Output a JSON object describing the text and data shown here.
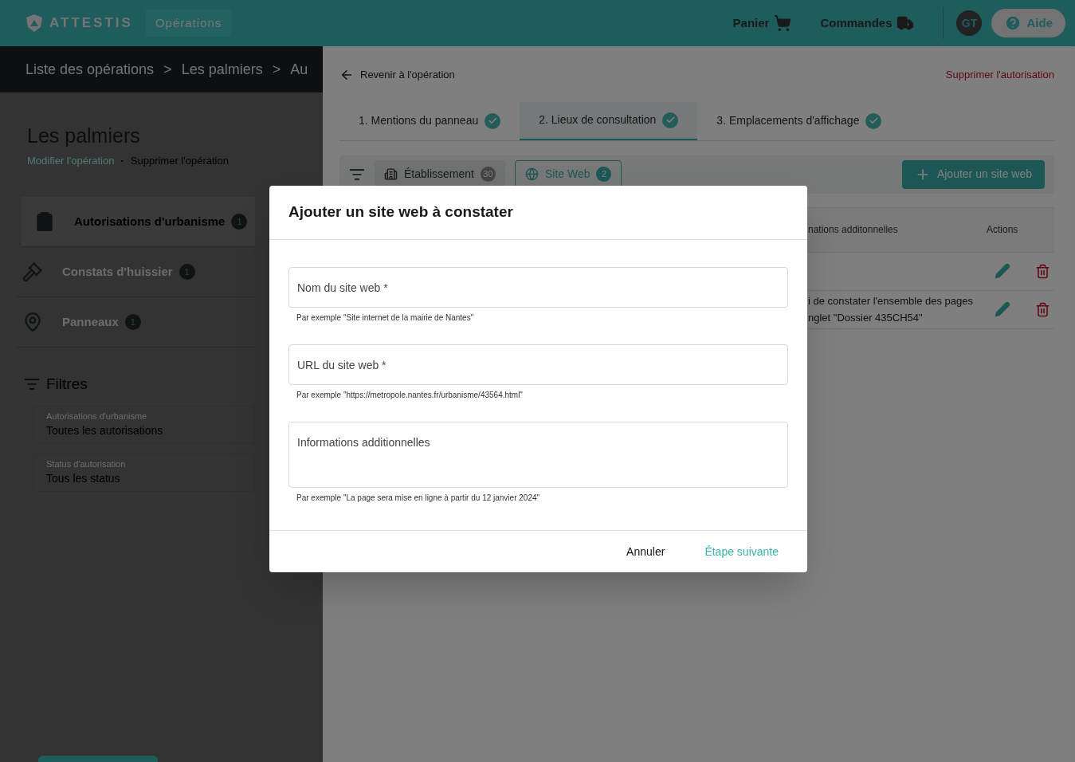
{
  "header": {
    "logo_text": "ATTESTIS",
    "nav_item": "Opérations",
    "links": [
      {
        "kind": "cart",
        "label": "Panier"
      },
      {
        "kind": "truck",
        "label": "Commandes"
      }
    ],
    "avatar": "GT",
    "help_button": "Aide"
  },
  "breadcrumb": {
    "items": [
      "Liste des opérations",
      "Les palmiers",
      "Au"
    ],
    "separator": ">"
  },
  "operation": {
    "title": "Les palmiers",
    "edit_link": "Modifier l'opération",
    "separator": "·",
    "delete_link": "Supprimer l'opération"
  },
  "sidebar": {
    "items": [
      {
        "kind": "clipboard",
        "label": "Autorisations d'urbanisme",
        "count": "1",
        "selected": true
      },
      {
        "kind": "gavel",
        "label": "Constats d'huissier",
        "count": "1",
        "selected": false
      },
      {
        "kind": "pin",
        "label": "Panneaux",
        "count": "1",
        "selected": false
      }
    ],
    "filters_title": "Filtres",
    "filters": [
      {
        "label": "Autorisations d'urbanisme",
        "value": "Toutes les autorisations"
      },
      {
        "label": "Status d'autorisation",
        "value": "Tous les status"
      }
    ]
  },
  "content": {
    "back_link": "Revenir à l'opération",
    "delete_link": "Supprimer l'autorisation",
    "steps": [
      {
        "label": "1. Mentions du panneau",
        "done": true,
        "selected": false
      },
      {
        "label": "2. Lieux de consultation",
        "done": true,
        "selected": true
      },
      {
        "label": "3. Emplacements d'affichage",
        "done": true,
        "selected": false
      }
    ],
    "chips": [
      {
        "kind": "building",
        "label": "Établissement",
        "count": "30",
        "selected": false
      },
      {
        "kind": "globe",
        "label": "Site Web",
        "count": "2",
        "selected": true
      }
    ],
    "add_button": "Ajouter un site web",
    "table": {
      "columns": [
        "nations additonnelles",
        "Actions"
      ],
      "rows": [
        {},
        {
          "info_lines": [
            "i de constater l'ensemble des pages",
            "nglet \"Dossier 435CH54\""
          ]
        }
      ]
    }
  },
  "modal": {
    "title": "Ajouter un site web à constater",
    "fields": [
      {
        "kind": "input",
        "placeholder": "Nom du site web *",
        "hint": "Par exemple \"Site internet de la mairie de Nantes\""
      },
      {
        "kind": "input",
        "placeholder": "URL du site web *",
        "hint": "Par exemple \"https://metropole.nantes.fr/urbanisme/43564.html\""
      },
      {
        "kind": "textarea",
        "placeholder": "Informations additionnelles",
        "hint": "Par exemple \"La page sera mise en ligne à partir du 12 janvier 2024\""
      }
    ],
    "cancel_button": "Annuler",
    "next_button": "Étape suivante"
  }
}
